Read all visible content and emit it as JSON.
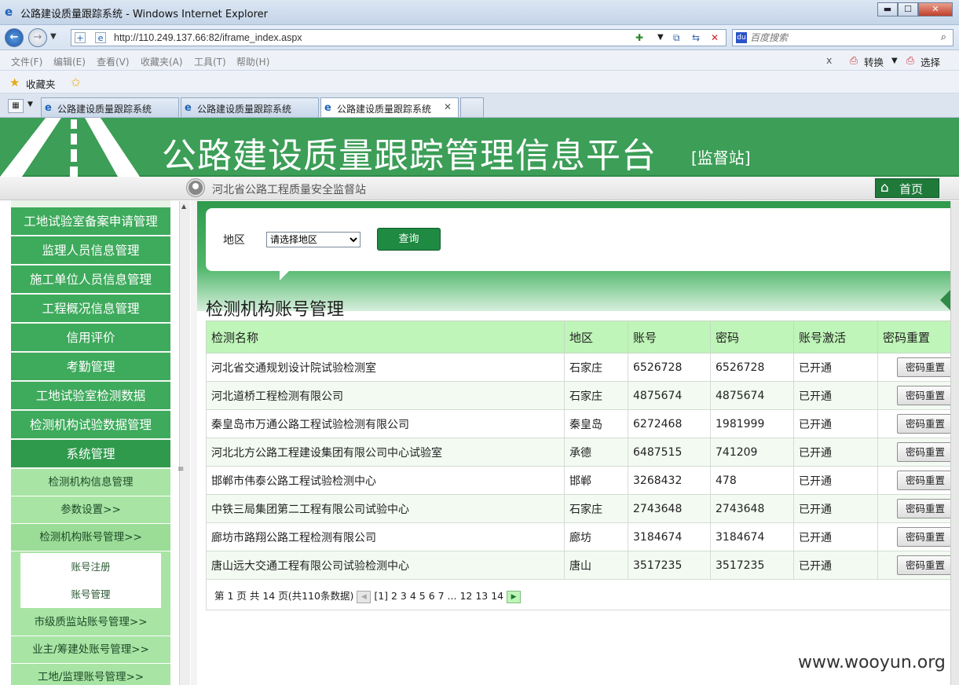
{
  "window": {
    "title": "公路建设质量跟踪系统 - Windows Internet Explorer",
    "minimize": "▬",
    "maximize": "☐",
    "close": "✕"
  },
  "address": {
    "url": "http://110.249.137.66:82/iframe_index.aspx",
    "search_placeholder": "百度搜索"
  },
  "menu": {
    "items": [
      "文件(F)",
      "编辑(E)",
      "查看(V)",
      "收藏夹(A)",
      "工具(T)",
      "帮助(H)"
    ],
    "close_x": "x",
    "convert": "转换",
    "select": "选择"
  },
  "favorites": {
    "label": "收藏夹"
  },
  "tabs": [
    {
      "label": "公路建设质量跟踪系统",
      "active": false
    },
    {
      "label": "公路建设质量跟踪系统",
      "active": false
    },
    {
      "label": "公路建设质量跟踪系统",
      "active": true
    }
  ],
  "banner": {
    "title": "公路建设质量跟踪管理信息平台",
    "subtitle": "[监督站]"
  },
  "infobar": {
    "org": "河北省公路工程质量安全监督站",
    "home": "首页"
  },
  "sidebar": {
    "items": [
      "工地试验室备案申请管理",
      "监理人员信息管理",
      "施工单位人员信息管理",
      "工程概况信息管理",
      "信用评价",
      "考勤管理",
      "工地试验室检测数据",
      "检测机构试验数据管理",
      "系统管理"
    ],
    "subitems": [
      "检测机构信息管理",
      "参数设置>>",
      "检测机构账号管理>>"
    ],
    "subsubitems": [
      "账号注册",
      "账号管理"
    ],
    "more": [
      "市级质监站账号管理>>",
      "业主/筹建处账号管理>>",
      "工地/监理账号管理>>"
    ]
  },
  "filter": {
    "label": "地区",
    "select_value": "请选择地区",
    "query": "查询"
  },
  "section_title": "检测机构账号管理",
  "table": {
    "headers": [
      "检测名称",
      "地区",
      "账号",
      "密码",
      "账号激活",
      "密码重置"
    ],
    "rows": [
      [
        "河北省交通规划设计院试验检测室",
        "石家庄",
        "6526728",
        "6526728",
        "已开通"
      ],
      [
        "河北道桥工程检测有限公司",
        "石家庄",
        "4875674",
        "4875674",
        "已开通"
      ],
      [
        "秦皇岛市万通公路工程试验检测有限公司",
        "秦皇岛",
        "6272468",
        "1981999",
        "已开通"
      ],
      [
        "河北北方公路工程建设集团有限公司中心试验室",
        "承德",
        "6487515",
        "741209",
        "已开通"
      ],
      [
        "邯郸市伟泰公路工程试验检测中心",
        "邯郸",
        "3268432",
        "478",
        "已开通"
      ],
      [
        "中铁三局集团第二工程有限公司试验中心",
        "石家庄",
        "2743648",
        "2743648",
        "已开通"
      ],
      [
        "廊坊市路翔公路工程检测有限公司",
        "廊坊",
        "3184674",
        "3184674",
        "已开通"
      ],
      [
        "唐山远大交通工程有限公司试验检测中心",
        "唐山",
        "3517235",
        "3517235",
        "已开通"
      ]
    ],
    "reset_label": "密码重置"
  },
  "pager": {
    "summary": "第 1 页 共 14 页(共110条数据)",
    "pages": "[1] 2 3 4 5 6 7 ... 12 13 14"
  },
  "watermark": "www.wooyun.org"
}
